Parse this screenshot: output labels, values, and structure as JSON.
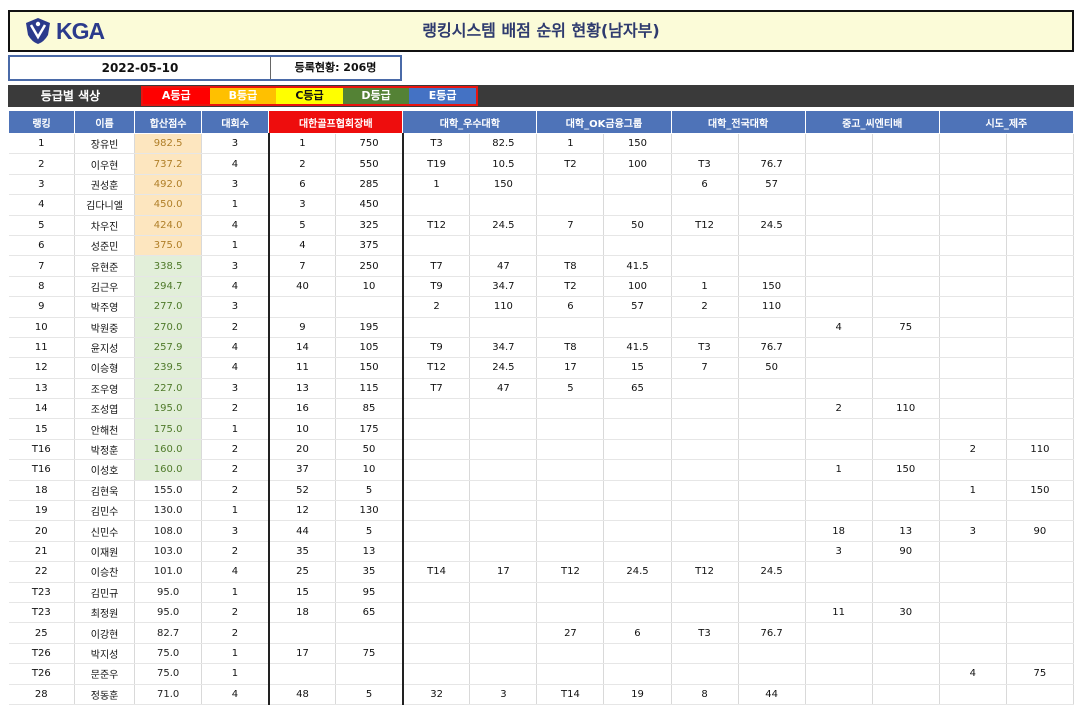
{
  "header": {
    "logo_text": "KGA",
    "title": "랭킹시스템 배점 순위 현황(남자부)"
  },
  "info": {
    "date": "2022-05-10",
    "registration": "등록현황: 206명"
  },
  "legend": {
    "label": "등급별 색상",
    "grades": [
      {
        "label": "A등급",
        "bg": "#ff0000",
        "fg": "#ffffff"
      },
      {
        "label": "B등급",
        "bg": "#ffc000",
        "fg": "#ffffff"
      },
      {
        "label": "C등급",
        "bg": "#ffff00",
        "fg": "#111111"
      },
      {
        "label": "D등급",
        "bg": "#548235",
        "fg": "#ffffff"
      },
      {
        "label": "E등급",
        "bg": "#4472c4",
        "fg": "#ffffff"
      }
    ]
  },
  "columns": {
    "rank": "랭킹",
    "name": "이름",
    "total": "합산점수",
    "events": "대회수",
    "groups": [
      "대한골프협회장배",
      "대학_우수대학",
      "대학_OK금융그룹",
      "대학_전국대학",
      "중고_씨엔티배",
      "시도_제주"
    ]
  },
  "rows": [
    {
      "rank": "1",
      "name": "장유빈",
      "total": "982.5",
      "tier": "a",
      "events": "3",
      "cells": [
        "1",
        "750",
        "T3",
        "82.5",
        "1",
        "150",
        "",
        "",
        "",
        "",
        "",
        ""
      ]
    },
    {
      "rank": "2",
      "name": "이우현",
      "total": "737.2",
      "tier": "a",
      "events": "4",
      "cells": [
        "2",
        "550",
        "T19",
        "10.5",
        "T2",
        "100",
        "T3",
        "76.7",
        "",
        "",
        "",
        ""
      ]
    },
    {
      "rank": "3",
      "name": "권성훈",
      "total": "492.0",
      "tier": "a",
      "events": "3",
      "cells": [
        "6",
        "285",
        "1",
        "150",
        "",
        "",
        "6",
        "57",
        "",
        "",
        "",
        ""
      ]
    },
    {
      "rank": "4",
      "name": "김다니엘",
      "total": "450.0",
      "tier": "a",
      "events": "1",
      "cells": [
        "3",
        "450",
        "",
        "",
        "",
        "",
        "",
        "",
        "",
        "",
        "",
        ""
      ]
    },
    {
      "rank": "5",
      "name": "차우진",
      "total": "424.0",
      "tier": "a",
      "events": "4",
      "cells": [
        "5",
        "325",
        "T12",
        "24.5",
        "7",
        "50",
        "T12",
        "24.5",
        "",
        "",
        "",
        ""
      ]
    },
    {
      "rank": "6",
      "name": "성준민",
      "total": "375.0",
      "tier": "a",
      "events": "1",
      "cells": [
        "4",
        "375",
        "",
        "",
        "",
        "",
        "",
        "",
        "",
        "",
        "",
        ""
      ]
    },
    {
      "rank": "7",
      "name": "유현준",
      "total": "338.5",
      "tier": "g",
      "events": "3",
      "cells": [
        "7",
        "250",
        "T7",
        "47",
        "T8",
        "41.5",
        "",
        "",
        "",
        "",
        "",
        ""
      ]
    },
    {
      "rank": "8",
      "name": "김근우",
      "total": "294.7",
      "tier": "g",
      "events": "4",
      "cells": [
        "40",
        "10",
        "T9",
        "34.7",
        "T2",
        "100",
        "1",
        "150",
        "",
        "",
        "",
        ""
      ]
    },
    {
      "rank": "9",
      "name": "박주영",
      "total": "277.0",
      "tier": "g",
      "events": "3",
      "cells": [
        "",
        "",
        "2",
        "110",
        "6",
        "57",
        "2",
        "110",
        "",
        "",
        "",
        ""
      ]
    },
    {
      "rank": "10",
      "name": "박원중",
      "total": "270.0",
      "tier": "g",
      "events": "2",
      "cells": [
        "9",
        "195",
        "",
        "",
        "",
        "",
        "",
        "",
        "4",
        "75",
        "",
        ""
      ]
    },
    {
      "rank": "11",
      "name": "윤지성",
      "total": "257.9",
      "tier": "g",
      "events": "4",
      "cells": [
        "14",
        "105",
        "T9",
        "34.7",
        "T8",
        "41.5",
        "T3",
        "76.7",
        "",
        "",
        "",
        ""
      ]
    },
    {
      "rank": "12",
      "name": "이승형",
      "total": "239.5",
      "tier": "g",
      "events": "4",
      "cells": [
        "11",
        "150",
        "T12",
        "24.5",
        "17",
        "15",
        "7",
        "50",
        "",
        "",
        "",
        ""
      ]
    },
    {
      "rank": "13",
      "name": "조우영",
      "total": "227.0",
      "tier": "g",
      "events": "3",
      "cells": [
        "13",
        "115",
        "T7",
        "47",
        "5",
        "65",
        "",
        "",
        "",
        "",
        "",
        ""
      ]
    },
    {
      "rank": "14",
      "name": "조성엽",
      "total": "195.0",
      "tier": "g",
      "events": "2",
      "cells": [
        "16",
        "85",
        "",
        "",
        "",
        "",
        "",
        "",
        "2",
        "110",
        "",
        ""
      ]
    },
    {
      "rank": "15",
      "name": "안해천",
      "total": "175.0",
      "tier": "g",
      "events": "1",
      "cells": [
        "10",
        "175",
        "",
        "",
        "",
        "",
        "",
        "",
        "",
        "",
        "",
        ""
      ]
    },
    {
      "rank": "T16",
      "name": "박정훈",
      "total": "160.0",
      "tier": "g",
      "events": "2",
      "cells": [
        "20",
        "50",
        "",
        "",
        "",
        "",
        "",
        "",
        "",
        "",
        "2",
        "110"
      ]
    },
    {
      "rank": "T16",
      "name": "이성호",
      "total": "160.0",
      "tier": "g",
      "events": "2",
      "cells": [
        "37",
        "10",
        "",
        "",
        "",
        "",
        "",
        "",
        "1",
        "150",
        "",
        ""
      ]
    },
    {
      "rank": "18",
      "name": "김현욱",
      "total": "155.0",
      "tier": "n",
      "events": "2",
      "cells": [
        "52",
        "5",
        "",
        "",
        "",
        "",
        "",
        "",
        "",
        "",
        "1",
        "150"
      ]
    },
    {
      "rank": "19",
      "name": "김민수",
      "total": "130.0",
      "tier": "n",
      "events": "1",
      "cells": [
        "12",
        "130",
        "",
        "",
        "",
        "",
        "",
        "",
        "",
        "",
        "",
        ""
      ]
    },
    {
      "rank": "20",
      "name": "신민수",
      "total": "108.0",
      "tier": "n",
      "events": "3",
      "cells": [
        "44",
        "5",
        "",
        "",
        "",
        "",
        "",
        "",
        "18",
        "13",
        "3",
        "90"
      ]
    },
    {
      "rank": "21",
      "name": "이재원",
      "total": "103.0",
      "tier": "n",
      "events": "2",
      "cells": [
        "35",
        "13",
        "",
        "",
        "",
        "",
        "",
        "",
        "3",
        "90",
        "",
        ""
      ]
    },
    {
      "rank": "22",
      "name": "이승찬",
      "total": "101.0",
      "tier": "n",
      "events": "4",
      "cells": [
        "25",
        "35",
        "T14",
        "17",
        "T12",
        "24.5",
        "T12",
        "24.5",
        "",
        "",
        "",
        ""
      ]
    },
    {
      "rank": "T23",
      "name": "김민규",
      "total": "95.0",
      "tier": "n",
      "events": "1",
      "cells": [
        "15",
        "95",
        "",
        "",
        "",
        "",
        "",
        "",
        "",
        "",
        "",
        ""
      ]
    },
    {
      "rank": "T23",
      "name": "최정원",
      "total": "95.0",
      "tier": "n",
      "events": "2",
      "cells": [
        "18",
        "65",
        "",
        "",
        "",
        "",
        "",
        "",
        "11",
        "30",
        "",
        ""
      ]
    },
    {
      "rank": "25",
      "name": "이강현",
      "total": "82.7",
      "tier": "n",
      "events": "2",
      "cells": [
        "",
        "",
        "",
        "",
        "27",
        "6",
        "T3",
        "76.7",
        "",
        "",
        "",
        ""
      ]
    },
    {
      "rank": "T26",
      "name": "박지성",
      "total": "75.0",
      "tier": "n",
      "events": "1",
      "cells": [
        "17",
        "75",
        "",
        "",
        "",
        "",
        "",
        "",
        "",
        "",
        "",
        ""
      ]
    },
    {
      "rank": "T26",
      "name": "문준우",
      "total": "75.0",
      "tier": "n",
      "events": "1",
      "cells": [
        "",
        "",
        "",
        "",
        "",
        "",
        "",
        "",
        "",
        "",
        "4",
        "75"
      ]
    },
    {
      "rank": "28",
      "name": "정동훈",
      "total": "71.0",
      "tier": "n",
      "events": "4",
      "cells": [
        "48",
        "5",
        "32",
        "3",
        "T14",
        "19",
        "8",
        "44",
        "",
        "",
        "",
        ""
      ]
    }
  ]
}
